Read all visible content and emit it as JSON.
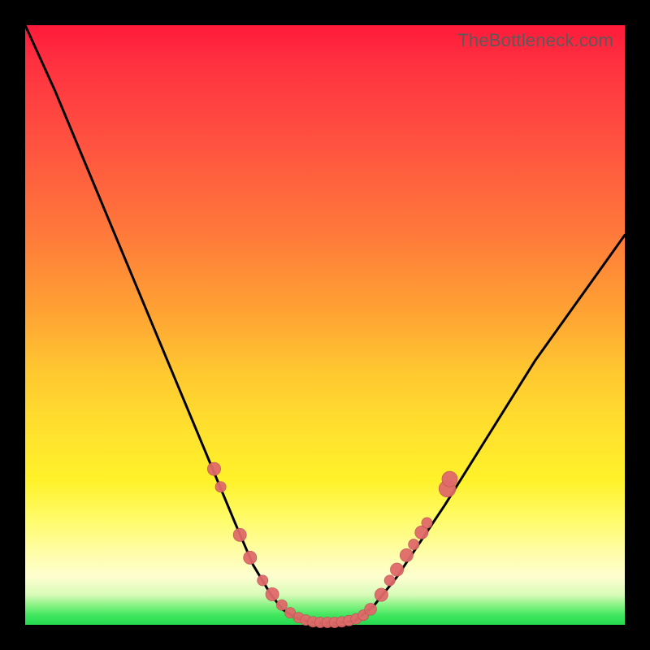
{
  "watermark": "TheBottleneck.com",
  "colors": {
    "frame": "#000000",
    "curve": "#000000",
    "marker_fill": "#e06a6a",
    "marker_stroke": "#b84d4d"
  },
  "chart_data": {
    "type": "line",
    "title": "",
    "xlabel": "",
    "ylabel": "",
    "xlim": [
      0,
      100
    ],
    "ylim": [
      0,
      100
    ],
    "grid": false,
    "legend": false,
    "series": [
      {
        "name": "left-curve",
        "x": [
          0,
          5,
          10,
          15,
          20,
          25,
          30,
          35,
          38,
          41,
          43,
          45,
          47
        ],
        "y": [
          100,
          89,
          77,
          65,
          53,
          41,
          29,
          17,
          10,
          5,
          2.5,
          1.2,
          0.6
        ]
      },
      {
        "name": "floor",
        "x": [
          47,
          48,
          49,
          50,
          51,
          52,
          53,
          54,
          55
        ],
        "y": [
          0.6,
          0.4,
          0.3,
          0.3,
          0.3,
          0.3,
          0.4,
          0.5,
          0.7
        ]
      },
      {
        "name": "right-curve",
        "x": [
          55,
          58,
          62,
          66,
          70,
          75,
          80,
          85,
          90,
          95,
          100
        ],
        "y": [
          0.7,
          3,
          8,
          14,
          20,
          28,
          36,
          44,
          51,
          58,
          65
        ]
      }
    ],
    "markers": [
      {
        "x": 31.5,
        "y": 26.0,
        "r": 1.1
      },
      {
        "x": 32.6,
        "y": 23.0,
        "r": 0.9
      },
      {
        "x": 35.8,
        "y": 15.0,
        "r": 1.1
      },
      {
        "x": 37.5,
        "y": 11.2,
        "r": 1.1
      },
      {
        "x": 39.6,
        "y": 7.4,
        "r": 0.9
      },
      {
        "x": 41.2,
        "y": 5.1,
        "r": 1.1
      },
      {
        "x": 42.8,
        "y": 3.3,
        "r": 0.9
      },
      {
        "x": 44.2,
        "y": 2.0,
        "r": 0.9
      },
      {
        "x": 45.6,
        "y": 1.2,
        "r": 0.9
      },
      {
        "x": 46.8,
        "y": 0.8,
        "r": 0.9
      },
      {
        "x": 48.0,
        "y": 0.5,
        "r": 0.9
      },
      {
        "x": 49.2,
        "y": 0.4,
        "r": 0.9
      },
      {
        "x": 50.4,
        "y": 0.4,
        "r": 0.9
      },
      {
        "x": 51.6,
        "y": 0.4,
        "r": 0.9
      },
      {
        "x": 52.8,
        "y": 0.5,
        "r": 0.9
      },
      {
        "x": 54.0,
        "y": 0.7,
        "r": 0.9
      },
      {
        "x": 55.2,
        "y": 1.0,
        "r": 0.9
      },
      {
        "x": 56.4,
        "y": 1.6,
        "r": 0.9
      },
      {
        "x": 57.6,
        "y": 2.6,
        "r": 1.0
      },
      {
        "x": 59.4,
        "y": 5.0,
        "r": 1.1
      },
      {
        "x": 60.8,
        "y": 7.4,
        "r": 0.9
      },
      {
        "x": 62.0,
        "y": 9.2,
        "r": 1.1
      },
      {
        "x": 63.6,
        "y": 11.6,
        "r": 1.1
      },
      {
        "x": 64.8,
        "y": 13.4,
        "r": 0.9
      },
      {
        "x": 66.1,
        "y": 15.4,
        "r": 1.1
      },
      {
        "x": 67.0,
        "y": 17.0,
        "r": 0.9
      },
      {
        "x": 70.4,
        "y": 22.7,
        "r": 1.4
      },
      {
        "x": 70.8,
        "y": 24.3,
        "r": 1.3
      }
    ]
  }
}
